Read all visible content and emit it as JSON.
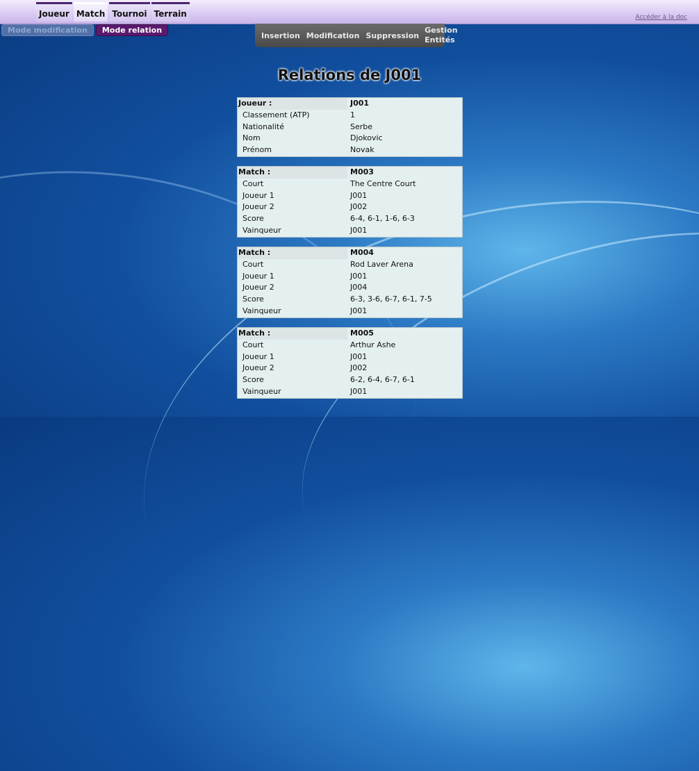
{
  "nav": {
    "tabs": [
      "Joueur",
      "Match",
      "Tournoi",
      "Terrain"
    ],
    "doc_link": "Accéder à la doc"
  },
  "modes": {
    "modification": "Mode modification",
    "relation": "Mode relation"
  },
  "actions": {
    "insertion": "Insertion",
    "modification": "Modification",
    "suppression": "Suppression",
    "gestion_line1": "Gestion",
    "gestion_line2": "Entités"
  },
  "title": "Relations de J001",
  "cards": [
    {
      "header_label": "Joueur :",
      "header_value": "J001",
      "rows": [
        [
          "Classement (ATP)",
          "1"
        ],
        [
          "Nationalité",
          "Serbe"
        ],
        [
          "Nom",
          "Djokovic"
        ],
        [
          "Prénom",
          "Novak"
        ]
      ]
    },
    {
      "header_label": "Match :",
      "header_value": "M003",
      "rows": [
        [
          "Court",
          "The Centre Court"
        ],
        [
          "Joueur 1",
          "J001"
        ],
        [
          "Joueur 2",
          "J002"
        ],
        [
          "Score",
          "6-4, 6-1, 1-6, 6-3"
        ],
        [
          "Vainqueur",
          "J001"
        ]
      ]
    },
    {
      "header_label": "Match :",
      "header_value": "M004",
      "rows": [
        [
          "Court",
          "Rod Laver Arena"
        ],
        [
          "Joueur 1",
          "J001"
        ],
        [
          "Joueur 2",
          "J004"
        ],
        [
          "Score",
          "6-3, 3-6, 6-7, 6-1, 7-5"
        ],
        [
          "Vainqueur",
          "J001"
        ]
      ]
    },
    {
      "header_label": "Match :",
      "header_value": "M005",
      "rows": [
        [
          "Court",
          "Arthur Ashe"
        ],
        [
          "Joueur 1",
          "J001"
        ],
        [
          "Joueur 2",
          "J002"
        ],
        [
          "Score",
          "6-2, 6-4, 6-7, 6-1"
        ],
        [
          "Vainqueur",
          "J001"
        ]
      ]
    }
  ]
}
